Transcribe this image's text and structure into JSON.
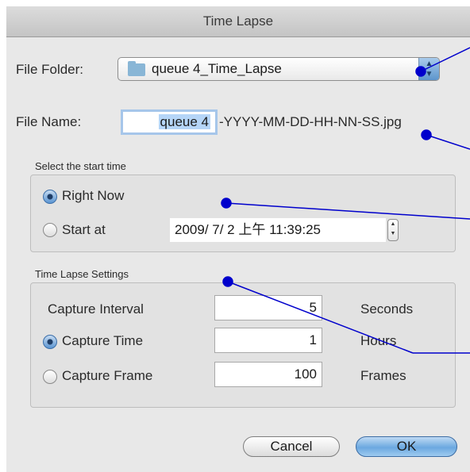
{
  "window": {
    "title": "Time Lapse"
  },
  "file_folder": {
    "label": "File Folder:",
    "value": "queue 4_Time_Lapse",
    "icon": "folder-icon"
  },
  "file_name": {
    "label": "File Name:",
    "value": "queue 4",
    "suffix": "-YYYY-MM-DD-HH-NN-SS.jpg"
  },
  "start_time": {
    "group_title": "Select the start time",
    "right_now_label": "Right Now",
    "right_now_selected": true,
    "start_at_label": "Start at",
    "start_at_selected": false,
    "datetime_value": "2009/  7/  2 上午 11:39:25"
  },
  "time_lapse_settings": {
    "group_title": "Time Lapse Settings",
    "capture_interval": {
      "label": "Capture Interval",
      "value": "5",
      "unit": "Seconds"
    },
    "capture_time": {
      "label": "Capture Time",
      "value": "1",
      "unit": "Hours",
      "selected": true
    },
    "capture_frame": {
      "label": "Capture Frame",
      "value": "100",
      "unit": "Frames",
      "selected": false
    }
  },
  "buttons": {
    "cancel": "Cancel",
    "ok": "OK"
  },
  "colors": {
    "accent": "#5d95cc",
    "annotation": "#0000cc"
  }
}
